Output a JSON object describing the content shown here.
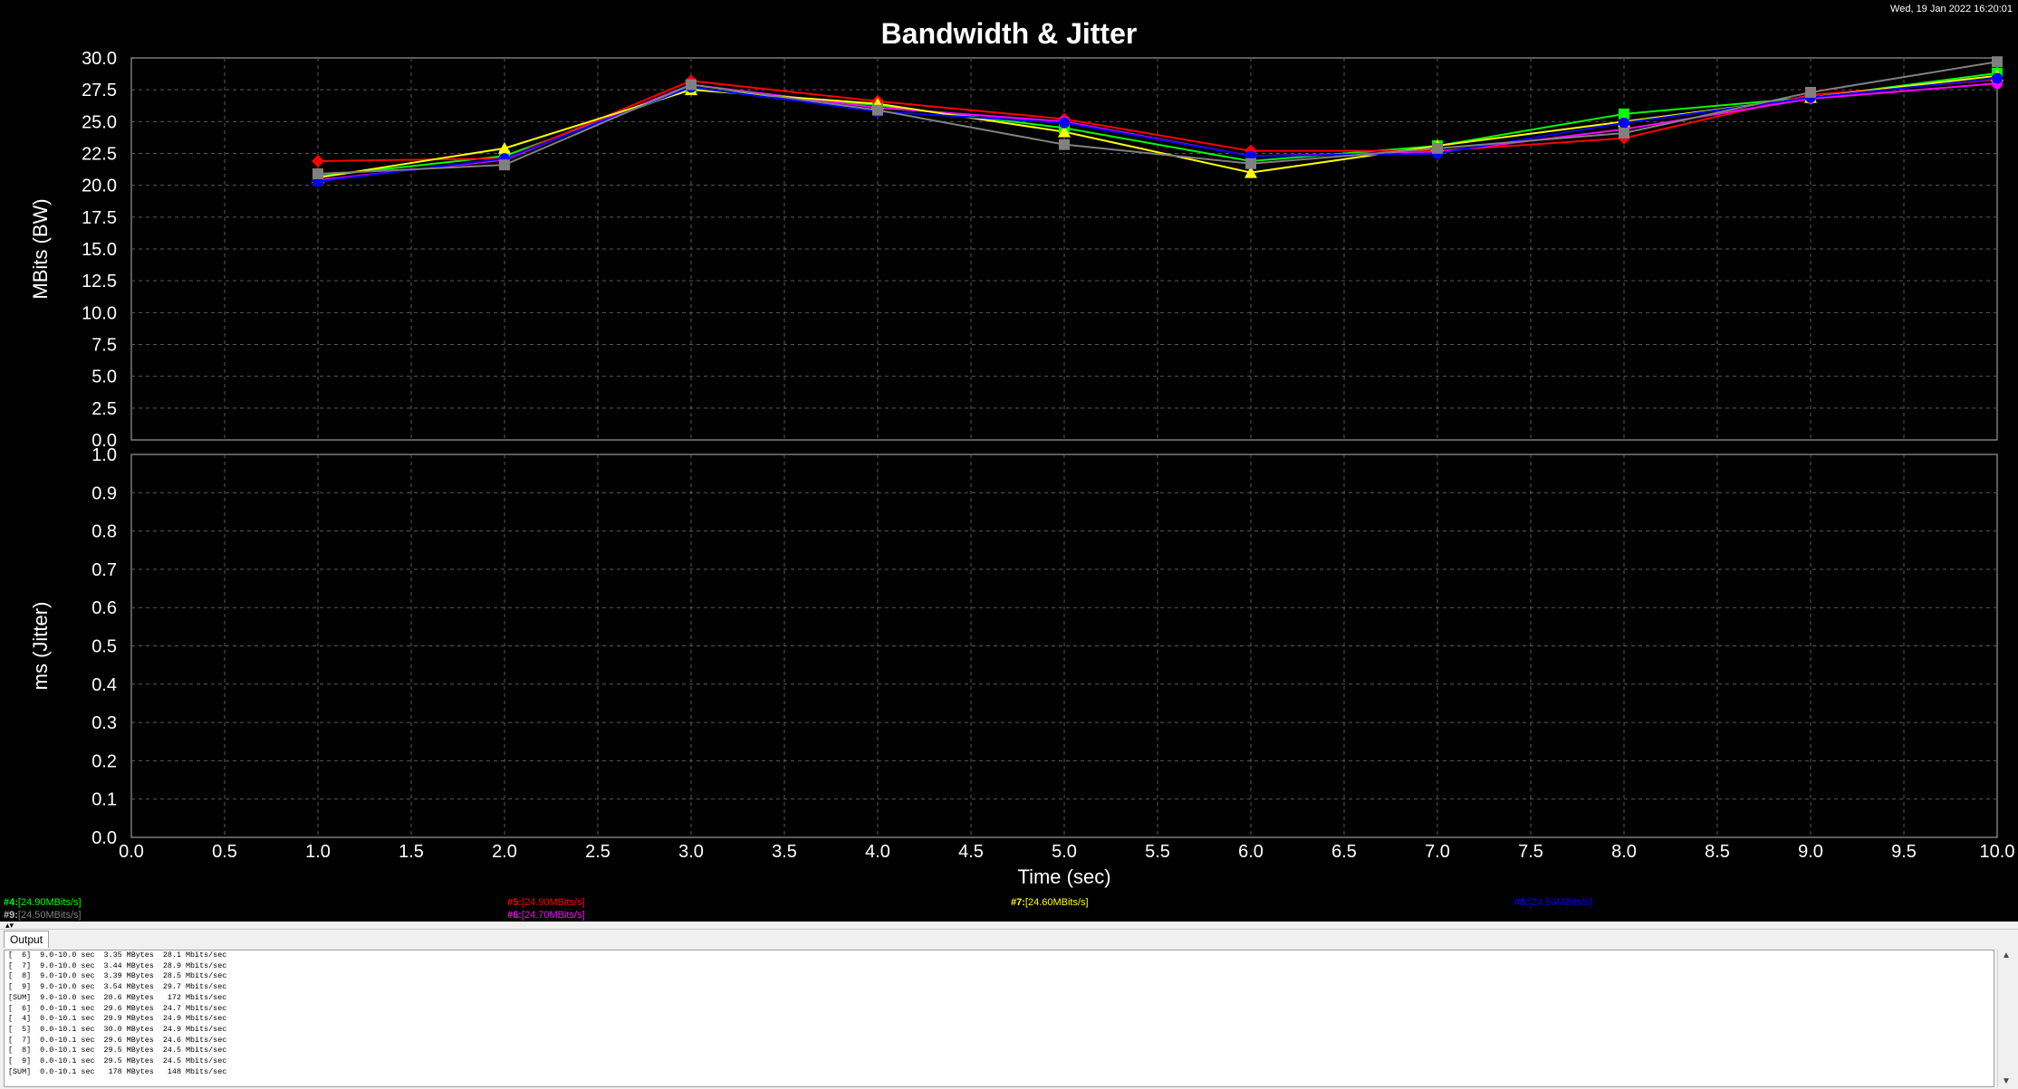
{
  "window": {
    "timestamp": "Wed, 19 Jan 2022 16:20:01"
  },
  "chart_data": {
    "type": "line",
    "title": "Bandwidth & Jitter",
    "xlabel": "Time (sec)",
    "xlim": [
      0,
      10
    ],
    "x_ticks": [
      "0.0",
      "0.5",
      "1.0",
      "1.5",
      "2.0",
      "2.5",
      "3.0",
      "3.5",
      "4.0",
      "4.5",
      "5.0",
      "5.5",
      "6.0",
      "6.5",
      "7.0",
      "7.5",
      "8.0",
      "8.5",
      "9.0",
      "9.5",
      "10.0"
    ],
    "grid": true,
    "panels": [
      {
        "ylabel": "MBits (BW)",
        "ylim": [
          0,
          30
        ],
        "y_ticks": [
          "0.0",
          "2.5",
          "5.0",
          "7.5",
          "10.0",
          "12.5",
          "15.0",
          "17.5",
          "20.0",
          "22.5",
          "25.0",
          "27.5",
          "30.0"
        ],
        "x": [
          1,
          2,
          3,
          4,
          5,
          6,
          7,
          8,
          9,
          10
        ],
        "series": [
          {
            "id": "#4",
            "color": "#00ff00",
            "marker": "square",
            "values": [
              20.7,
              22.3,
              27.6,
              26.3,
              24.5,
              21.9,
              23.1,
              25.6,
              26.9,
              28.8
            ]
          },
          {
            "id": "#5",
            "color": "#ff0000",
            "marker": "diamond",
            "values": [
              21.9,
              22.1,
              28.2,
              26.6,
              25.2,
              22.7,
              22.7,
              23.7,
              27.1,
              28.3
            ]
          },
          {
            "id": "#6",
            "color": "#ff00ff",
            "marker": "circle",
            "values": [
              20.4,
              22.0,
              27.9,
              26.1,
              25.0,
              22.3,
              22.6,
              24.4,
              26.8,
              28.0
            ]
          },
          {
            "id": "#7",
            "color": "#ffff00",
            "marker": "triangle",
            "values": [
              20.6,
              22.9,
              27.5,
              26.4,
              24.2,
              21.0,
              23.1,
              25.0,
              26.9,
              28.6
            ]
          },
          {
            "id": "#8",
            "color": "#0000ff",
            "marker": "circle",
            "values": [
              20.3,
              22.1,
              27.7,
              25.8,
              24.9,
              22.3,
              22.5,
              24.9,
              26.9,
              28.4
            ]
          },
          {
            "id": "#9",
            "color": "#808080",
            "marker": "square",
            "values": [
              20.9,
              21.6,
              27.9,
              25.9,
              23.2,
              21.7,
              22.9,
              24.1,
              27.3,
              29.7
            ]
          }
        ]
      },
      {
        "ylabel": "ms (Jitter)",
        "ylim": [
          0,
          1
        ],
        "y_ticks": [
          "0.0",
          "0.1",
          "0.2",
          "0.3",
          "0.4",
          "0.5",
          "0.6",
          "0.7",
          "0.8",
          "0.9",
          "1.0"
        ],
        "series": []
      }
    ]
  },
  "legend": [
    {
      "id": "#4:",
      "value": "[24.90MBits/s]",
      "color": "#00ff00",
      "id_color": "#00ff00"
    },
    {
      "id": "#5:",
      "value": "[24.90MBits/s]",
      "color": "#ff0000",
      "id_color": "#ff0000"
    },
    {
      "id": "#7:",
      "value": "[24.60MBits/s]",
      "color": "#ffff00",
      "id_color": "#ffff00"
    },
    {
      "id": "#8:",
      "value": "[24.50MBits/s]",
      "color": "#0000ff",
      "id_color": "#0000ff"
    },
    {
      "id": "#9:",
      "value": "[24.50MBits/s]",
      "color": "#808080",
      "id_color": "#c0c0c0"
    },
    {
      "id": "#6:",
      "value": "[24.70MBits/s]",
      "color": "#ff00ff",
      "id_color": "#ff00ff"
    }
  ],
  "output": {
    "tab_label": "Output",
    "lines": [
      "[  6]  9.0-10.0 sec  3.35 MBytes  28.1 Mbits/sec",
      "[  7]  9.0-10.0 sec  3.44 MBytes  28.9 Mbits/sec",
      "[  8]  9.0-10.0 sec  3.39 MBytes  28.5 Mbits/sec",
      "[  9]  9.0-10.0 sec  3.54 MBytes  29.7 Mbits/sec",
      "[SUM]  9.0-10.0 sec  20.6 MBytes   172 Mbits/sec",
      "[  6]  0.0-10.1 sec  29.6 MBytes  24.7 Mbits/sec",
      "[  4]  0.0-10.1 sec  29.9 MBytes  24.9 Mbits/sec",
      "[  5]  0.0-10.1 sec  30.0 MBytes  24.9 Mbits/sec",
      "[  7]  0.0-10.1 sec  29.6 MBytes  24.6 Mbits/sec",
      "[  8]  0.0-10.1 sec  29.5 MBytes  24.5 Mbits/sec",
      "[  9]  0.0-10.1 sec  29.5 MBytes  24.5 Mbits/sec",
      "[SUM]  0.0-10.1 sec   178 MBytes   148 Mbits/sec"
    ]
  }
}
